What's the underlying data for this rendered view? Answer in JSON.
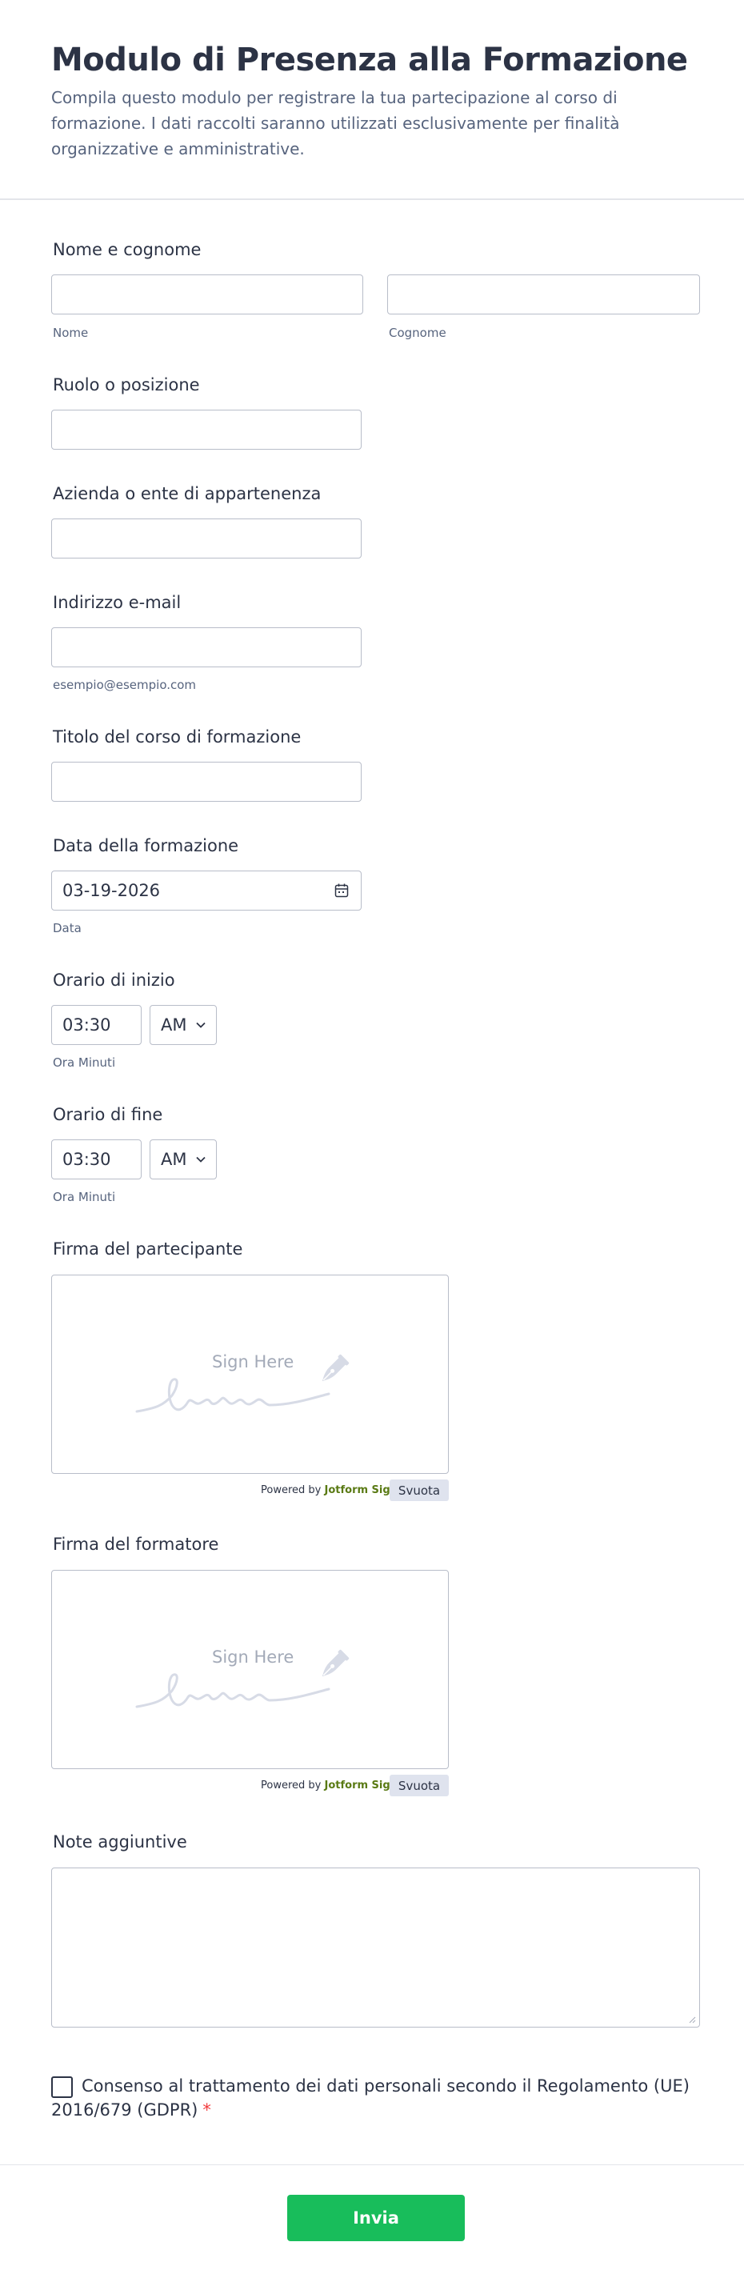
{
  "header": {
    "title": "Modulo di Presenza alla Formazione",
    "description": "Compila questo modulo per registrare la tua partecipazione al corso di formazione. I dati raccolti saranno utilizzati esclusivamente per finalità organizzative e amministrative."
  },
  "fields": {
    "name": {
      "label": "Nome e cognome",
      "first_sublabel": "Nome",
      "last_sublabel": "Cognome",
      "first_value": "",
      "last_value": ""
    },
    "role": {
      "label": "Ruolo o posizione",
      "value": ""
    },
    "company": {
      "label": "Azienda o ente di appartenenza",
      "value": ""
    },
    "email": {
      "label": "Indirizzo e-mail",
      "value": "",
      "sublabel": "esempio@esempio.com"
    },
    "course_title": {
      "label": "Titolo del corso di formazione",
      "value": ""
    },
    "date": {
      "label": "Data della formazione",
      "value": "03-19-2026",
      "sublabel": "Data"
    },
    "start_time": {
      "label": "Orario di inizio",
      "time": "03:30",
      "ampm": "AM",
      "sublabel": "Ora Minuti"
    },
    "end_time": {
      "label": "Orario di fine",
      "time": "03:30",
      "ampm": "AM",
      "sublabel": "Ora Minuti"
    },
    "participant_signature": {
      "label": "Firma del partecipante",
      "hint": "Sign Here",
      "powered_prefix": "Powered by",
      "powered_brand": "Jotform Sign",
      "clear_label": "Svuota"
    },
    "trainer_signature": {
      "label": "Firma del formatore",
      "hint": "Sign Here",
      "powered_prefix": "Powered by",
      "powered_brand": "Jotform Sign",
      "clear_label": "Svuota"
    },
    "notes": {
      "label": "Note aggiuntive",
      "value": ""
    },
    "consent": {
      "label": "Consenso al trattamento dei dati personali secondo il Regolamento (UE) 2016/679 (GDPR)",
      "required_mark": "*",
      "checked": false
    }
  },
  "submit": {
    "label": "Invia"
  },
  "colors": {
    "accent": "#18bd5b",
    "text": "#2c3345",
    "muted": "#57647e",
    "border": "#b8bdc9",
    "required": "#f23a3c",
    "brand": "#5a7a14"
  },
  "icons": {
    "date": "calendar-icon",
    "select": "chevron-down-icon",
    "signature": "pen-nib-icon",
    "resize": "resize-grip-icon"
  }
}
